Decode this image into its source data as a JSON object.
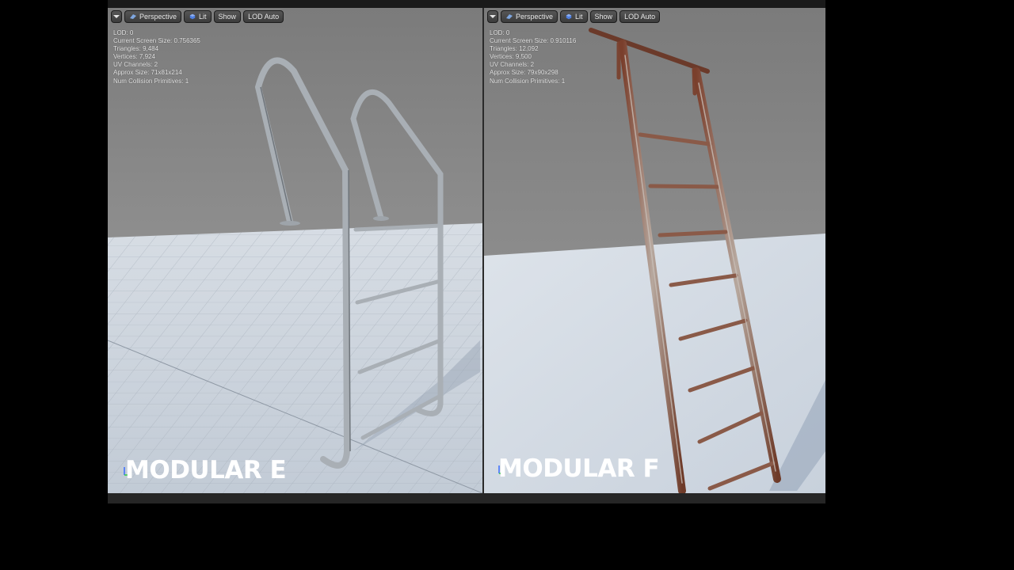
{
  "viewports": [
    {
      "toolbar": {
        "menu_icon": "chevron-down-icon",
        "perspective": "Perspective",
        "lit": "Lit",
        "show": "Show",
        "lod": "LOD Auto"
      },
      "stats": [
        {
          "label": "LOD:",
          "value": "0"
        },
        {
          "label": "Current Screen Size:",
          "value": "0.756365"
        },
        {
          "label": "Triangles:",
          "value": "9,484"
        },
        {
          "label": "Vertices:",
          "value": "7,924"
        },
        {
          "label": "UV Channels:",
          "value": "2"
        },
        {
          "label": "Approx Size:",
          "value": "71x81x214"
        },
        {
          "label": "Num Collision Primitives:",
          "value": "1"
        }
      ],
      "label": "MODULAR E"
    },
    {
      "toolbar": {
        "menu_icon": "chevron-down-icon",
        "perspective": "Perspective",
        "lit": "Lit",
        "show": "Show",
        "lod": "LOD Auto"
      },
      "stats": [
        {
          "label": "LOD:",
          "value": "0"
        },
        {
          "label": "Current Screen Size:",
          "value": "0.910116"
        },
        {
          "label": "Triangles:",
          "value": "12,092"
        },
        {
          "label": "Vertices:",
          "value": "9,500"
        },
        {
          "label": "UV Channels:",
          "value": "2"
        },
        {
          "label": "Approx Size:",
          "value": "79x90x298"
        },
        {
          "label": "Num Collision Primitives:",
          "value": "1"
        }
      ],
      "label": "MODULAR F"
    }
  ],
  "colors": {
    "sky": "#888888",
    "floor": "#c9d1dc",
    "steel": "#a9afb5",
    "rust": "#8a4a36"
  }
}
